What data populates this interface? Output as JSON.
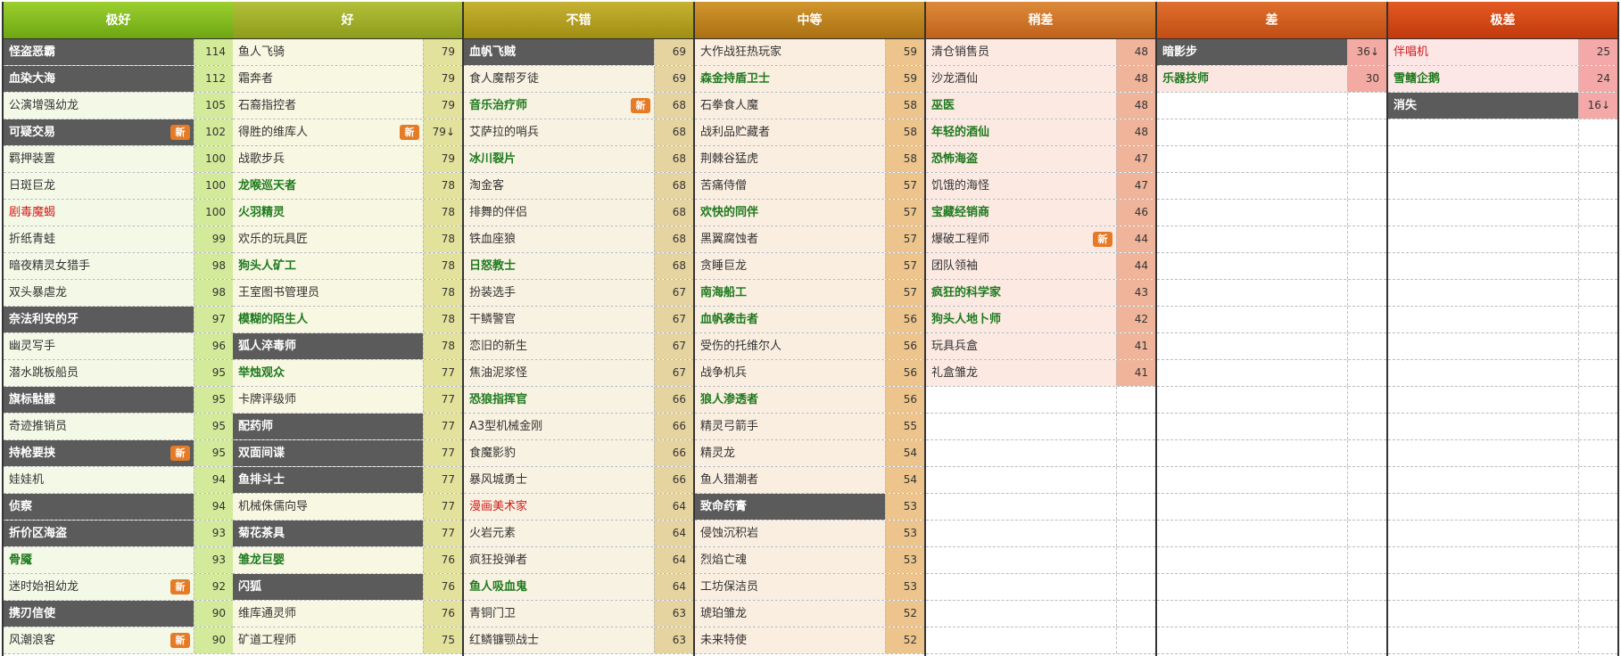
{
  "new_badge_label": "新",
  "tiers": [
    {
      "key": "t1",
      "label": "极好",
      "header_bg": "linear-gradient(#9bd02e,#6ea613)",
      "row_bg": "#f3f9e6",
      "val_bg": "#d3ea9a",
      "items": [
        {
          "name": "怪盗恶霸",
          "value": "114",
          "style": "dark"
        },
        {
          "name": "血染大海",
          "value": "112",
          "style": "dark"
        },
        {
          "name": "公演增强幼龙",
          "value": "105"
        },
        {
          "name": "可疑交易",
          "value": "102",
          "style": "dark",
          "badge": true
        },
        {
          "name": "羁押装置",
          "value": "100"
        },
        {
          "name": "日斑巨龙",
          "value": "100"
        },
        {
          "name": "剧毒魔蝎",
          "value": "100",
          "style": "red"
        },
        {
          "name": "折纸青蛙",
          "value": "99"
        },
        {
          "name": "暗夜精灵女猎手",
          "value": "98"
        },
        {
          "name": "双头暴虐龙",
          "value": "98"
        },
        {
          "name": "奈法利安的牙",
          "value": "97",
          "style": "dark"
        },
        {
          "name": "幽灵写手",
          "value": "96"
        },
        {
          "name": "潜水跳板船员",
          "value": "95"
        },
        {
          "name": "旗标骷髅",
          "value": "95",
          "style": "dark"
        },
        {
          "name": "奇迹推销员",
          "value": "95"
        },
        {
          "name": "持枪要挟",
          "value": "95",
          "style": "dark",
          "badge": true
        },
        {
          "name": "娃娃机",
          "value": "94"
        },
        {
          "name": "侦察",
          "value": "94",
          "style": "dark"
        },
        {
          "name": "折价区海盗",
          "value": "93",
          "style": "dark"
        },
        {
          "name": "骨魇",
          "value": "93",
          "style": "bold"
        },
        {
          "name": "迷时始祖幼龙",
          "value": "92",
          "badge": true
        },
        {
          "name": "携刃信使",
          "value": "90",
          "style": "dark"
        },
        {
          "name": "风潮浪客",
          "value": "90",
          "badge": true
        }
      ]
    },
    {
      "key": "t2",
      "label": "好",
      "header_bg": "linear-gradient(#b3c03a,#8d9c1a)",
      "row_bg": "#f7f7e2",
      "val_bg": "#e2e29c",
      "items": [
        {
          "name": "鱼人飞骑",
          "value": "79"
        },
        {
          "name": "霜奔者",
          "value": "79"
        },
        {
          "name": "石裔指控者",
          "value": "79"
        },
        {
          "name": "得胜的维库人",
          "value": "79↓",
          "badge": true
        },
        {
          "name": "战歌步兵",
          "value": "79"
        },
        {
          "name": "龙喉巡天者",
          "value": "78",
          "style": "bold"
        },
        {
          "name": "火羽精灵",
          "value": "78",
          "style": "bold"
        },
        {
          "name": "欢乐的玩具匠",
          "value": "78"
        },
        {
          "name": "狗头人矿工",
          "value": "78",
          "style": "bold"
        },
        {
          "name": "王室图书管理员",
          "value": "78"
        },
        {
          "name": "模糊的陌生人",
          "value": "78",
          "style": "bold"
        },
        {
          "name": "狐人淬毒师",
          "value": "78",
          "style": "dark"
        },
        {
          "name": "举烛观众",
          "value": "77",
          "style": "bold"
        },
        {
          "name": "卡牌评级师",
          "value": "77"
        },
        {
          "name": "配药师",
          "value": "77",
          "style": "dark"
        },
        {
          "name": "双面间谍",
          "value": "77",
          "style": "dark"
        },
        {
          "name": "鱼排斗士",
          "value": "77",
          "style": "dark"
        },
        {
          "name": "机械侏儒向导",
          "value": "77"
        },
        {
          "name": "菊花茶具",
          "value": "77",
          "style": "dark"
        },
        {
          "name": "雏龙巨婴",
          "value": "76",
          "style": "bold"
        },
        {
          "name": "闪狐",
          "value": "76",
          "style": "dark"
        },
        {
          "name": "维库通灵师",
          "value": "76"
        },
        {
          "name": "矿道工程师",
          "value": "75"
        }
      ]
    },
    {
      "key": "t3",
      "label": "不错",
      "header_bg": "linear-gradient(#c6b232,#a08d14)",
      "row_bg": "#f8f2e2",
      "val_bg": "#e6d4a0",
      "items": [
        {
          "name": "血帆飞贼",
          "value": "69",
          "style": "dark"
        },
        {
          "name": "食人魔帮歹徒",
          "value": "69"
        },
        {
          "name": "音乐治疗师",
          "value": "68",
          "style": "bold",
          "badge": true
        },
        {
          "name": "艾萨拉的哨兵",
          "value": "68"
        },
        {
          "name": "冰川裂片",
          "value": "68",
          "style": "bold"
        },
        {
          "name": "淘金客",
          "value": "68"
        },
        {
          "name": "排舞的伴侣",
          "value": "68"
        },
        {
          "name": "铁血座狼",
          "value": "68"
        },
        {
          "name": "日怒教士",
          "value": "68",
          "style": "bold"
        },
        {
          "name": "扮装选手",
          "value": "67"
        },
        {
          "name": "干鳞警官",
          "value": "67"
        },
        {
          "name": "恋旧的新生",
          "value": "67"
        },
        {
          "name": "焦油泥浆怪",
          "value": "67"
        },
        {
          "name": "恐狼指挥官",
          "value": "66",
          "style": "bold"
        },
        {
          "name": "A3型机械金刚",
          "value": "66"
        },
        {
          "name": "食魔影豹",
          "value": "66"
        },
        {
          "name": "暴风城勇士",
          "value": "66"
        },
        {
          "name": "漫画美术家",
          "value": "64",
          "style": "red"
        },
        {
          "name": "火岩元素",
          "value": "64"
        },
        {
          "name": "疯狂投弹者",
          "value": "64"
        },
        {
          "name": "鱼人吸血鬼",
          "value": "64",
          "style": "bold"
        },
        {
          "name": "青铜门卫",
          "value": "63"
        },
        {
          "name": "红鳞镰颚战士",
          "value": "63"
        }
      ]
    },
    {
      "key": "t4",
      "label": "中等",
      "header_bg": "linear-gradient(#d1962e,#ab7012)",
      "row_bg": "#faeee0",
      "val_bg": "#ecc48c",
      "items": [
        {
          "name": "大作战狂热玩家",
          "value": "59"
        },
        {
          "name": "森金持盾卫士",
          "value": "59",
          "style": "bold"
        },
        {
          "name": "石拳食人魔",
          "value": "58"
        },
        {
          "name": "战利品贮藏者",
          "value": "58"
        },
        {
          "name": "荆棘谷猛虎",
          "value": "58"
        },
        {
          "name": "苦痛侍僧",
          "value": "57"
        },
        {
          "name": "欢快的同伴",
          "value": "57",
          "style": "bold"
        },
        {
          "name": "黑翼腐蚀者",
          "value": "57"
        },
        {
          "name": "贪睡巨龙",
          "value": "57"
        },
        {
          "name": "南海船工",
          "value": "57",
          "style": "bold"
        },
        {
          "name": "血帆袭击者",
          "value": "56",
          "style": "bold"
        },
        {
          "name": "受伤的托维尔人",
          "value": "56"
        },
        {
          "name": "战争机兵",
          "value": "56"
        },
        {
          "name": "狼人渗透者",
          "value": "56",
          "style": "bold"
        },
        {
          "name": "精灵弓箭手",
          "value": "55"
        },
        {
          "name": "精灵龙",
          "value": "54"
        },
        {
          "name": "鱼人猎潮者",
          "value": "54"
        },
        {
          "name": "致命药膏",
          "value": "53",
          "style": "dark"
        },
        {
          "name": "侵蚀沉积岩",
          "value": "53"
        },
        {
          "name": "烈焰亡魂",
          "value": "53"
        },
        {
          "name": "工坊保洁员",
          "value": "53"
        },
        {
          "name": "琥珀雏龙",
          "value": "52"
        },
        {
          "name": "未来特使",
          "value": "52"
        }
      ]
    },
    {
      "key": "t5",
      "label": "稍差",
      "header_bg": "linear-gradient(#dd8a3a,#c0621a)",
      "row_bg": "#fbe9e2",
      "val_bg": "#f0b49a",
      "items": [
        {
          "name": "清仓销售员",
          "value": "48"
        },
        {
          "name": "沙龙酒仙",
          "value": "48"
        },
        {
          "name": "巫医",
          "value": "48",
          "style": "bold"
        },
        {
          "name": "年轻的酒仙",
          "value": "48",
          "style": "bold"
        },
        {
          "name": "恐怖海盗",
          "value": "47",
          "style": "bold"
        },
        {
          "name": "饥饿的海怪",
          "value": "47"
        },
        {
          "name": "宝藏经销商",
          "value": "46",
          "style": "bold"
        },
        {
          "name": "爆破工程师",
          "value": "44",
          "badge": true
        },
        {
          "name": "团队领袖",
          "value": "44"
        },
        {
          "name": "疯狂的科学家",
          "value": "43",
          "style": "bold"
        },
        {
          "name": "狗头人地卜师",
          "value": "42",
          "style": "bold"
        },
        {
          "name": "玩具兵盒",
          "value": "41"
        },
        {
          "name": "礼盒雏龙",
          "value": "41"
        }
      ]
    },
    {
      "key": "t6",
      "label": "差",
      "header_bg": "linear-gradient(#e0702e,#c24d14)",
      "row_bg": "#fce6e2",
      "val_bg": "#f3aaa2",
      "items": [
        {
          "name": "暗影步",
          "value": "36↓",
          "style": "dark"
        },
        {
          "name": "乐器技师",
          "value": "30",
          "style": "bold"
        }
      ]
    },
    {
      "key": "t7",
      "label": "极差",
      "header_bg": "linear-gradient(#e35a22,#c23a0c)",
      "row_bg": "#fde6e6",
      "val_bg": "#f4a8a8",
      "items": [
        {
          "name": "伴唱机",
          "value": "25",
          "style": "red"
        },
        {
          "name": "雪鳍企鹅",
          "value": "24",
          "style": "bold"
        },
        {
          "name": "消失",
          "value": "16↓",
          "style": "dark"
        }
      ]
    }
  ]
}
